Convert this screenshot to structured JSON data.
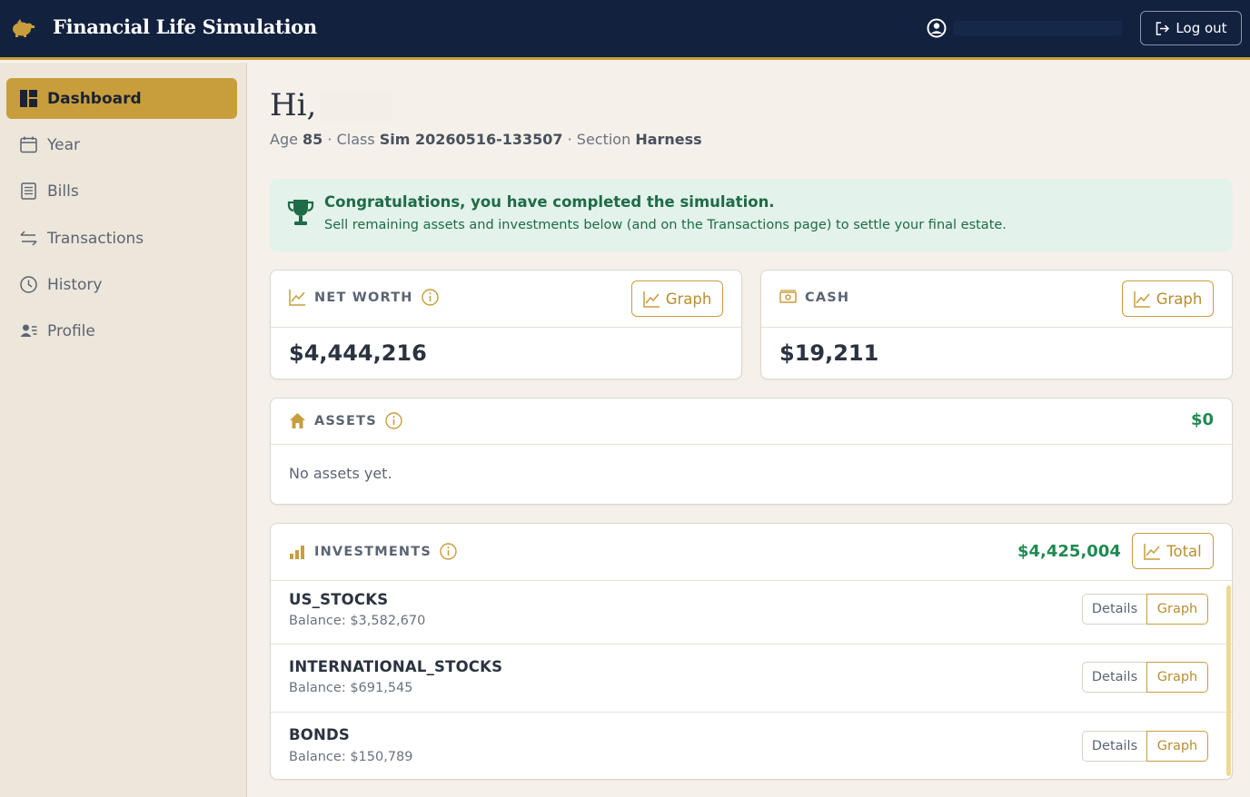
{
  "header": {
    "app_title": "Financial Life Simulation",
    "logout_label": "Log out",
    "brand_color": "#c89d3c",
    "bg_color": "#12213e"
  },
  "sidebar": {
    "items": [
      {
        "label": "Dashboard",
        "icon": "dashboard-icon",
        "active": true
      },
      {
        "label": "Year",
        "icon": "calendar-icon",
        "active": false
      },
      {
        "label": "Bills",
        "icon": "receipt-icon",
        "active": false
      },
      {
        "label": "Transactions",
        "icon": "arrows-exchange-icon",
        "active": false
      },
      {
        "label": "History",
        "icon": "clock-icon",
        "active": false
      },
      {
        "label": "Profile",
        "icon": "person-card-icon",
        "active": false
      }
    ]
  },
  "greeting": {
    "hi": "Hi,",
    "age_label": "Age",
    "age": "85",
    "class_label": "· Class",
    "class_name": "Sim 20260516-133507",
    "section_label": "· Section",
    "section_name": "Harness"
  },
  "alert": {
    "title": "Congratulations, you have completed the simulation.",
    "text": "Sell remaining assets and investments below (and on the Transactions page) to settle your final estate."
  },
  "net_worth": {
    "label": "NET WORTH",
    "value": "$4,444,216",
    "graph_label": "Graph"
  },
  "cash": {
    "label": "CASH",
    "value": "$19,211",
    "graph_label": "Graph"
  },
  "assets": {
    "label": "ASSETS",
    "total": "$0",
    "empty_text": "No assets yet."
  },
  "investments": {
    "label": "INVESTMENTS",
    "total": "$4,425,004",
    "total_button": "Total",
    "details_label": "Details",
    "graph_label": "Graph",
    "rows": [
      {
        "name": "US_STOCKS",
        "balance": "Balance: $3,582,670"
      },
      {
        "name": "INTERNATIONAL_STOCKS",
        "balance": "Balance: $691,545"
      },
      {
        "name": "BONDS",
        "balance": "Balance: $150,789"
      }
    ]
  }
}
